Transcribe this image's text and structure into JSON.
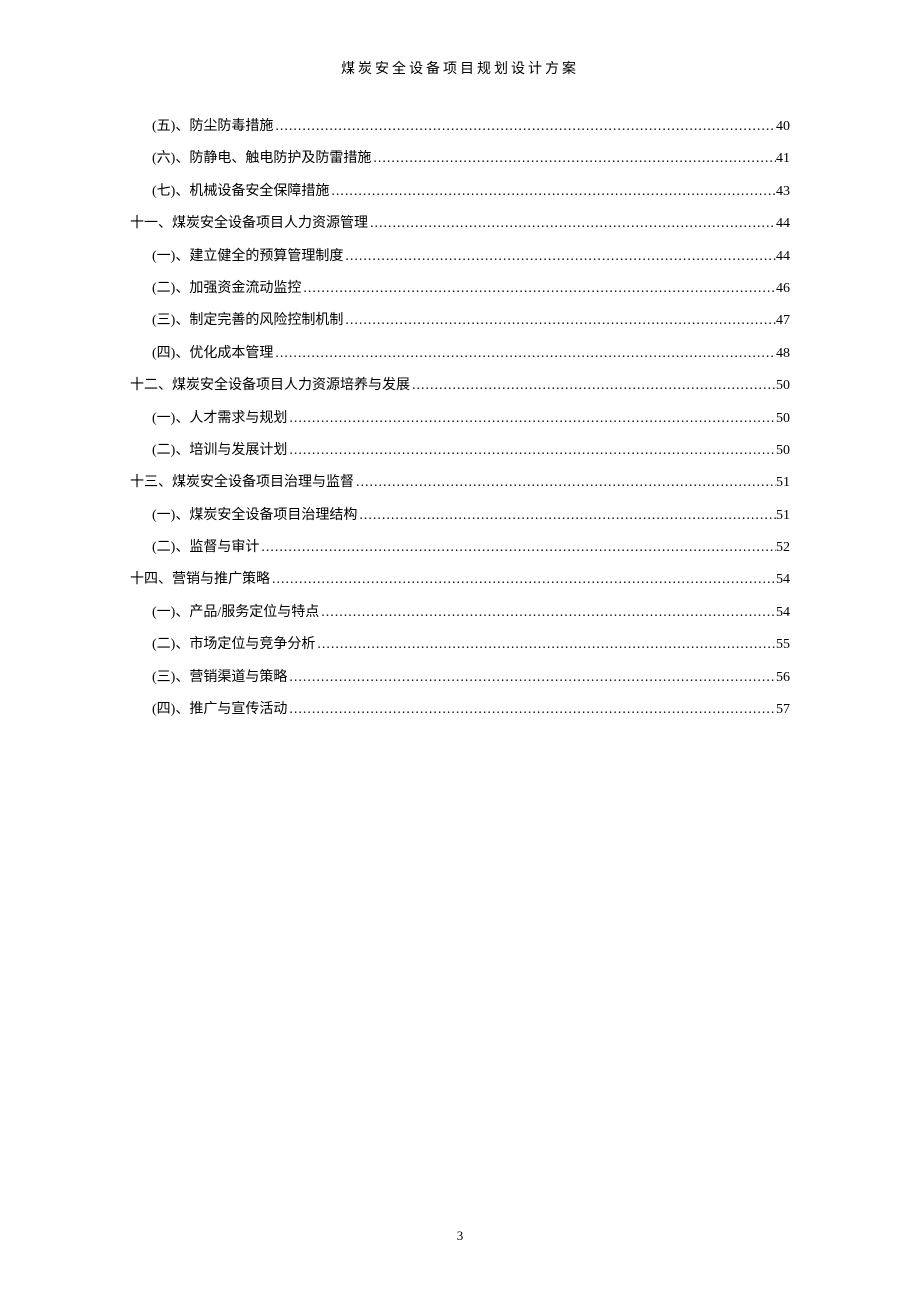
{
  "header": {
    "title": "煤炭安全设备项目规划设计方案"
  },
  "toc": [
    {
      "level": 2,
      "label": "(五)、防尘防毒措施",
      "page": "40"
    },
    {
      "level": 2,
      "label": "(六)、防静电、触电防护及防雷措施",
      "page": "41"
    },
    {
      "level": 2,
      "label": "(七)、机械设备安全保障措施",
      "page": "43"
    },
    {
      "level": 1,
      "label": "十一、煤炭安全设备项目人力资源管理",
      "page": "44"
    },
    {
      "level": 2,
      "label": "(一)、建立健全的预算管理制度",
      "page": "44"
    },
    {
      "level": 2,
      "label": "(二)、加强资金流动监控",
      "page": "46"
    },
    {
      "level": 2,
      "label": "(三)、制定完善的风险控制机制",
      "page": "47"
    },
    {
      "level": 2,
      "label": "(四)、优化成本管理",
      "page": "48"
    },
    {
      "level": 1,
      "label": "十二、煤炭安全设备项目人力资源培养与发展",
      "page": "50"
    },
    {
      "level": 2,
      "label": "(一)、人才需求与规划",
      "page": "50"
    },
    {
      "level": 2,
      "label": "(二)、培训与发展计划",
      "page": "50"
    },
    {
      "level": 1,
      "label": "十三、煤炭安全设备项目治理与监督",
      "page": "51"
    },
    {
      "level": 2,
      "label": "(一)、煤炭安全设备项目治理结构",
      "page": "51"
    },
    {
      "level": 2,
      "label": "(二)、监督与审计",
      "page": "52"
    },
    {
      "level": 1,
      "label": "十四、营销与推广策略",
      "page": "54"
    },
    {
      "level": 2,
      "label": "(一)、产品/服务定位与特点",
      "page": "54"
    },
    {
      "level": 2,
      "label": "(二)、市场定位与竞争分析",
      "page": "55"
    },
    {
      "level": 2,
      "label": "(三)、营销渠道与策略",
      "page": "56"
    },
    {
      "level": 2,
      "label": "(四)、推广与宣传活动",
      "page": "57"
    }
  ],
  "footer": {
    "pageNumber": "3"
  }
}
